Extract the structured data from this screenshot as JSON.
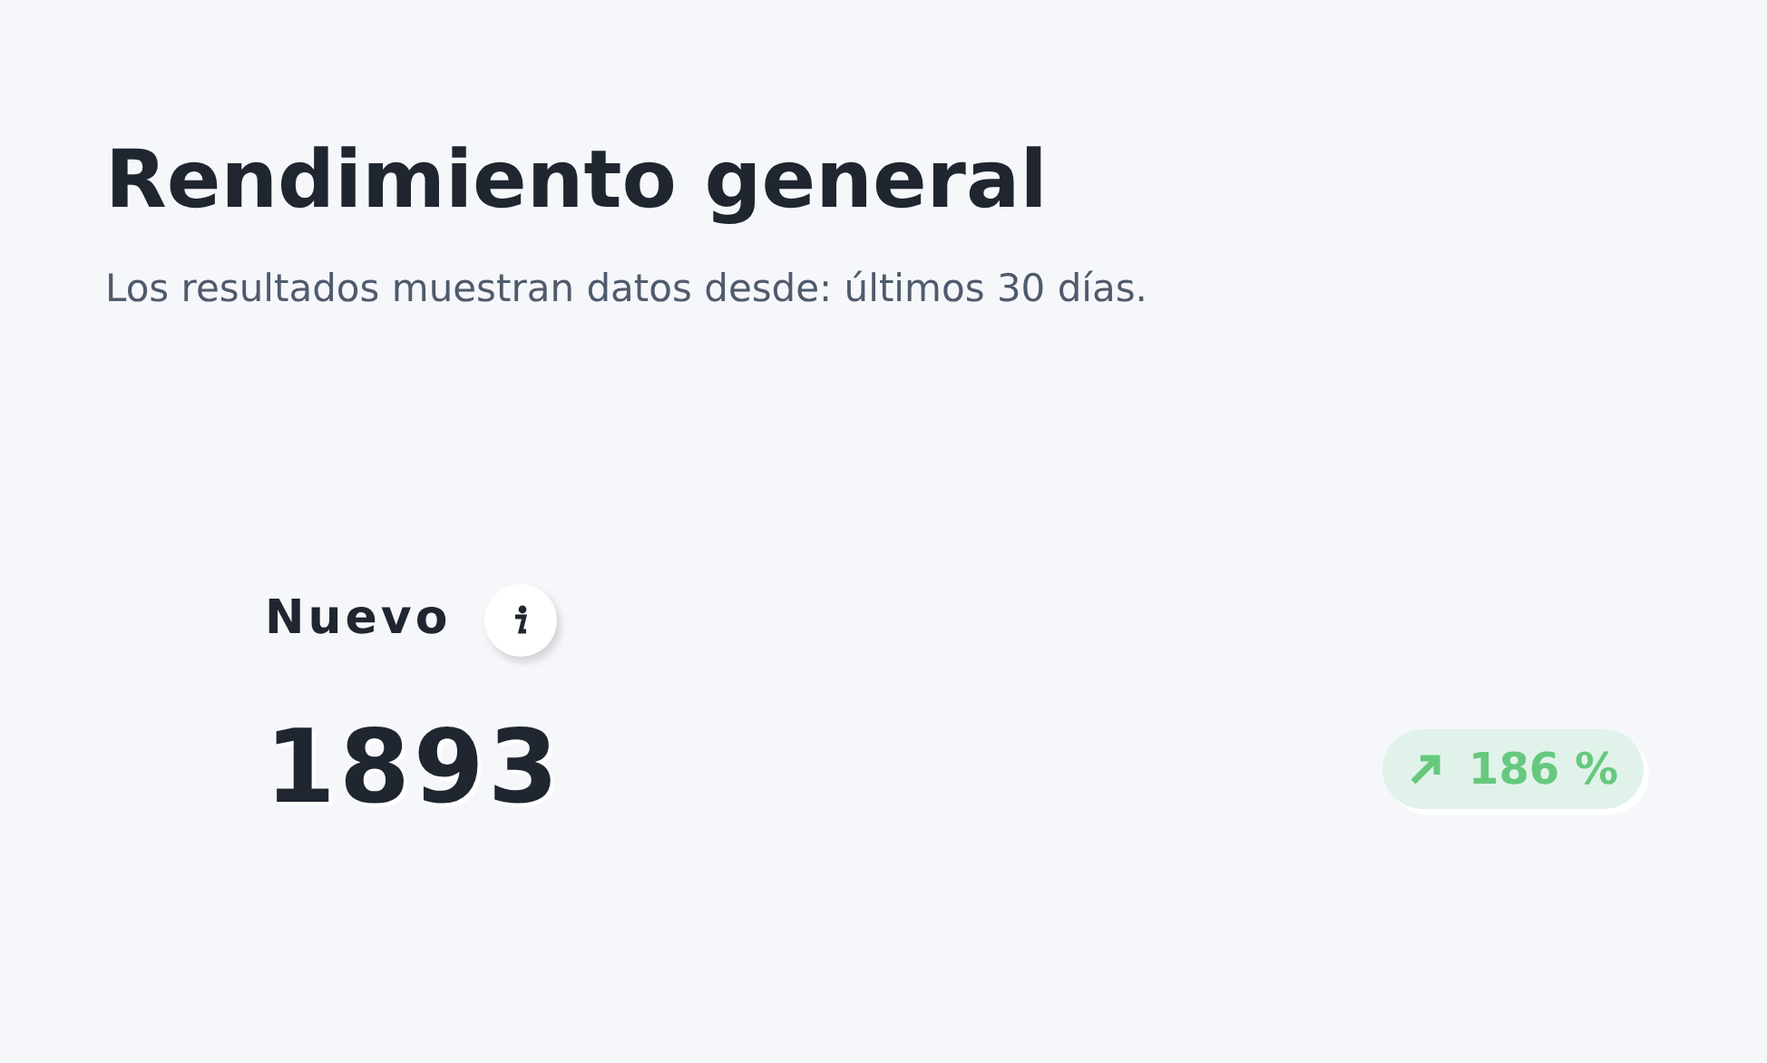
{
  "title": "Rendimiento general",
  "subtitle": "Los resultados muestran datos desde: últimos 30 días.",
  "metric": {
    "label": "Nuevo",
    "value": "1893",
    "change": {
      "kind": "increase",
      "text": "186 %"
    }
  }
}
